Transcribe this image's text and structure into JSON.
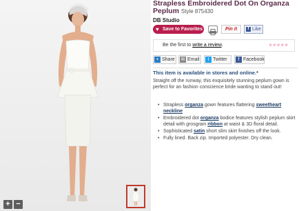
{
  "product": {
    "title": "Strapless Embroidered Dot On Organza Peplum",
    "style_number": "Style 875430",
    "brand": "DB Studio"
  },
  "actions": {
    "save_favorites": "Save to Favorites",
    "pinit": "Pin it",
    "like": "Like",
    "facebook_mark": "f"
  },
  "review": {
    "prefix": "Be the first to ",
    "link": "write a review",
    "suffix": ".",
    "hearts": "♥♥♥♥♥"
  },
  "share": {
    "share": "Share",
    "email": "Email",
    "twitter": "Twitter",
    "facebook": "Facebook"
  },
  "availability": "This item is available in stores and online.*",
  "description": "Straight off the runway, this exquisitely stunning peplum gown is perfect for an fashion conscience bride wanting to stand out!",
  "features": [
    {
      "pre": "Strapless ",
      "kw1": "organza",
      "mid": " gown features flattering ",
      "kw2": "sweetheart neckline",
      "post": ""
    },
    {
      "pre": "Embroidered dot ",
      "kw1": "organza",
      "mid": " bodice features stylish peplum skirt detail with grosgrain ",
      "kw2": "ribbon",
      "post": " at waist & 3D floral detail."
    },
    {
      "pre": "Sophisticated ",
      "kw1": "satin",
      "mid": " short slim skirt finishes off the look.",
      "kw2": "",
      "post": ""
    },
    {
      "pre": "Fully lined. Back zip. Imported polyester. Dry clean.",
      "kw1": "",
      "mid": "",
      "kw2": "",
      "post": ""
    }
  ],
  "image_controls": {
    "zoom_in": "+",
    "zoom_out": "−"
  },
  "colors": {
    "favorites": "#b81e4d",
    "title": "#5a2a4a",
    "link": "#1c3a63",
    "availability": "#2b4e7a"
  }
}
